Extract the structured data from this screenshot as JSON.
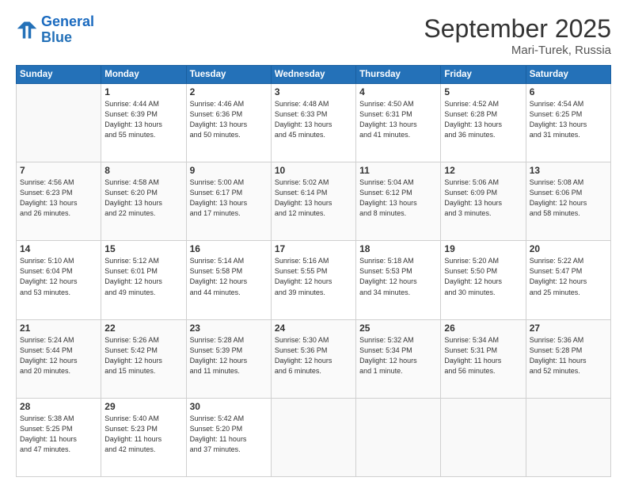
{
  "header": {
    "logo_line1": "General",
    "logo_line2": "Blue",
    "month": "September 2025",
    "location": "Mari-Turek, Russia"
  },
  "weekdays": [
    "Sunday",
    "Monday",
    "Tuesday",
    "Wednesday",
    "Thursday",
    "Friday",
    "Saturday"
  ],
  "weeks": [
    [
      {
        "day": "",
        "detail": ""
      },
      {
        "day": "1",
        "detail": "Sunrise: 4:44 AM\nSunset: 6:39 PM\nDaylight: 13 hours\nand 55 minutes."
      },
      {
        "day": "2",
        "detail": "Sunrise: 4:46 AM\nSunset: 6:36 PM\nDaylight: 13 hours\nand 50 minutes."
      },
      {
        "day": "3",
        "detail": "Sunrise: 4:48 AM\nSunset: 6:33 PM\nDaylight: 13 hours\nand 45 minutes."
      },
      {
        "day": "4",
        "detail": "Sunrise: 4:50 AM\nSunset: 6:31 PM\nDaylight: 13 hours\nand 41 minutes."
      },
      {
        "day": "5",
        "detail": "Sunrise: 4:52 AM\nSunset: 6:28 PM\nDaylight: 13 hours\nand 36 minutes."
      },
      {
        "day": "6",
        "detail": "Sunrise: 4:54 AM\nSunset: 6:25 PM\nDaylight: 13 hours\nand 31 minutes."
      }
    ],
    [
      {
        "day": "7",
        "detail": "Sunrise: 4:56 AM\nSunset: 6:23 PM\nDaylight: 13 hours\nand 26 minutes."
      },
      {
        "day": "8",
        "detail": "Sunrise: 4:58 AM\nSunset: 6:20 PM\nDaylight: 13 hours\nand 22 minutes."
      },
      {
        "day": "9",
        "detail": "Sunrise: 5:00 AM\nSunset: 6:17 PM\nDaylight: 13 hours\nand 17 minutes."
      },
      {
        "day": "10",
        "detail": "Sunrise: 5:02 AM\nSunset: 6:14 PM\nDaylight: 13 hours\nand 12 minutes."
      },
      {
        "day": "11",
        "detail": "Sunrise: 5:04 AM\nSunset: 6:12 PM\nDaylight: 13 hours\nand 8 minutes."
      },
      {
        "day": "12",
        "detail": "Sunrise: 5:06 AM\nSunset: 6:09 PM\nDaylight: 13 hours\nand 3 minutes."
      },
      {
        "day": "13",
        "detail": "Sunrise: 5:08 AM\nSunset: 6:06 PM\nDaylight: 12 hours\nand 58 minutes."
      }
    ],
    [
      {
        "day": "14",
        "detail": "Sunrise: 5:10 AM\nSunset: 6:04 PM\nDaylight: 12 hours\nand 53 minutes."
      },
      {
        "day": "15",
        "detail": "Sunrise: 5:12 AM\nSunset: 6:01 PM\nDaylight: 12 hours\nand 49 minutes."
      },
      {
        "day": "16",
        "detail": "Sunrise: 5:14 AM\nSunset: 5:58 PM\nDaylight: 12 hours\nand 44 minutes."
      },
      {
        "day": "17",
        "detail": "Sunrise: 5:16 AM\nSunset: 5:55 PM\nDaylight: 12 hours\nand 39 minutes."
      },
      {
        "day": "18",
        "detail": "Sunrise: 5:18 AM\nSunset: 5:53 PM\nDaylight: 12 hours\nand 34 minutes."
      },
      {
        "day": "19",
        "detail": "Sunrise: 5:20 AM\nSunset: 5:50 PM\nDaylight: 12 hours\nand 30 minutes."
      },
      {
        "day": "20",
        "detail": "Sunrise: 5:22 AM\nSunset: 5:47 PM\nDaylight: 12 hours\nand 25 minutes."
      }
    ],
    [
      {
        "day": "21",
        "detail": "Sunrise: 5:24 AM\nSunset: 5:44 PM\nDaylight: 12 hours\nand 20 minutes."
      },
      {
        "day": "22",
        "detail": "Sunrise: 5:26 AM\nSunset: 5:42 PM\nDaylight: 12 hours\nand 15 minutes."
      },
      {
        "day": "23",
        "detail": "Sunrise: 5:28 AM\nSunset: 5:39 PM\nDaylight: 12 hours\nand 11 minutes."
      },
      {
        "day": "24",
        "detail": "Sunrise: 5:30 AM\nSunset: 5:36 PM\nDaylight: 12 hours\nand 6 minutes."
      },
      {
        "day": "25",
        "detail": "Sunrise: 5:32 AM\nSunset: 5:34 PM\nDaylight: 12 hours\nand 1 minute."
      },
      {
        "day": "26",
        "detail": "Sunrise: 5:34 AM\nSunset: 5:31 PM\nDaylight: 11 hours\nand 56 minutes."
      },
      {
        "day": "27",
        "detail": "Sunrise: 5:36 AM\nSunset: 5:28 PM\nDaylight: 11 hours\nand 52 minutes."
      }
    ],
    [
      {
        "day": "28",
        "detail": "Sunrise: 5:38 AM\nSunset: 5:25 PM\nDaylight: 11 hours\nand 47 minutes."
      },
      {
        "day": "29",
        "detail": "Sunrise: 5:40 AM\nSunset: 5:23 PM\nDaylight: 11 hours\nand 42 minutes."
      },
      {
        "day": "30",
        "detail": "Sunrise: 5:42 AM\nSunset: 5:20 PM\nDaylight: 11 hours\nand 37 minutes."
      },
      {
        "day": "",
        "detail": ""
      },
      {
        "day": "",
        "detail": ""
      },
      {
        "day": "",
        "detail": ""
      },
      {
        "day": "",
        "detail": ""
      }
    ]
  ]
}
